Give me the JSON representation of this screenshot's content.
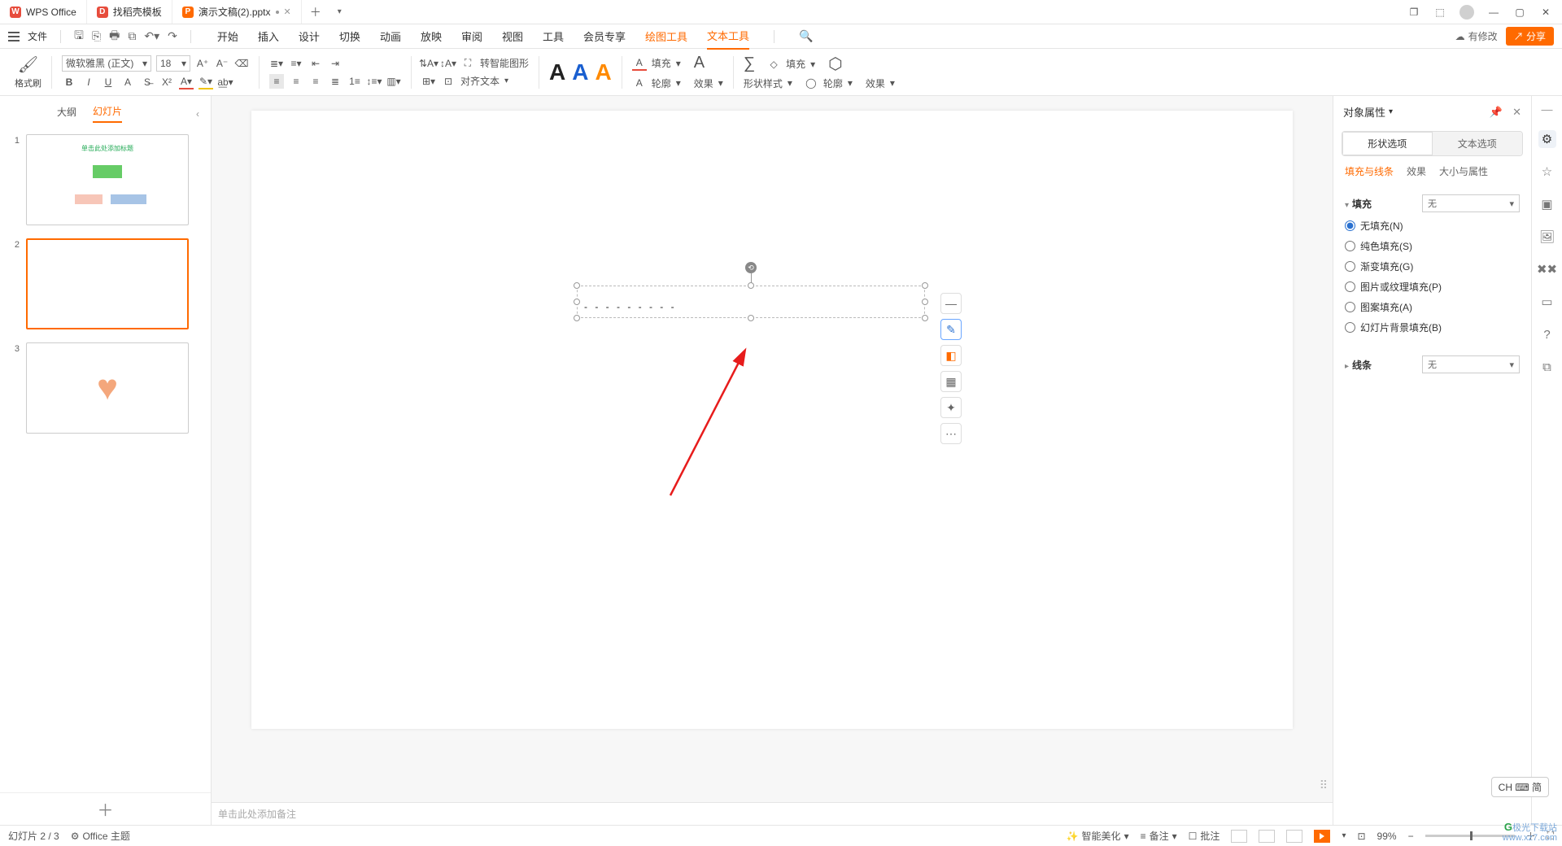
{
  "titlebar": {
    "tabs": [
      {
        "icon": "W",
        "label": "WPS Office"
      },
      {
        "icon": "D",
        "label": "找稻壳模板"
      },
      {
        "icon": "P",
        "label": "演示文稿(2).pptx",
        "modified": true
      }
    ]
  },
  "menubar": {
    "file": "文件",
    "tabs": [
      "开始",
      "插入",
      "设计",
      "切换",
      "动画",
      "放映",
      "审阅",
      "视图",
      "工具",
      "会员专享",
      "绘图工具",
      "文本工具"
    ],
    "active_tab": "文本工具",
    "modified_label": "有修改",
    "share": "分享"
  },
  "ribbon": {
    "format_painter": "格式刷",
    "font_name": "微软雅黑 (正文)",
    "font_size": "18",
    "smart_graphic": "转智能图形",
    "align_text": "对齐文本",
    "fill": "填充",
    "outline": "轮廓",
    "effect": "效果",
    "text_effect": "文本效果",
    "shape_style": "形状样式",
    "fill2": "填充",
    "outline2": "轮廓",
    "effect2": "效果"
  },
  "sidepanel": {
    "tab_outline": "大纲",
    "tab_slides": "幻灯片",
    "slides": [
      1,
      2,
      3
    ],
    "slide1_title": "单击此处添加标题"
  },
  "canvas": {
    "textbox_content": "- - - - - - - - -",
    "notes_placeholder": "单击此处添加备注"
  },
  "props": {
    "title": "对象属性",
    "seg_shape": "形状选项",
    "seg_text": "文本选项",
    "tab_fill_line": "填充与线条",
    "tab_effect": "效果",
    "tab_size": "大小与属性",
    "section_fill": "填充",
    "section_line": "线条",
    "none": "无",
    "fills": {
      "no_fill": "无填充(N)",
      "solid": "纯色填充(S)",
      "gradient": "渐变填充(G)",
      "picture": "图片或纹理填充(P)",
      "pattern": "图案填充(A)",
      "slide_bg": "幻灯片背景填充(B)"
    }
  },
  "statusbar": {
    "slide_count": "幻灯片 2 / 3",
    "theme": "Office 主题",
    "beautify": "智能美化",
    "notes": "备注",
    "comments": "批注",
    "zoom": "99%"
  },
  "ime": "CH ⌨ 简",
  "watermark": {
    "line1": "极光下载站",
    "line2": "www.xz7.com"
  }
}
